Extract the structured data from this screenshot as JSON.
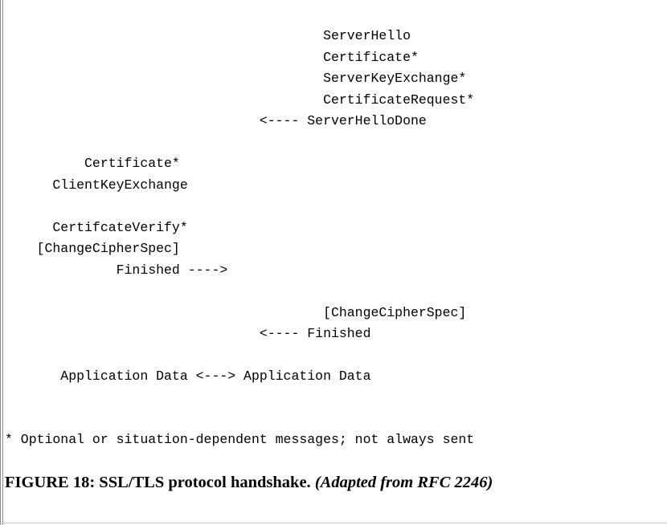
{
  "diagram": {
    "lines": [
      {
        "text": "                                        ServerHello"
      },
      {
        "text": "                                        Certificate*"
      },
      {
        "text": "                                        ServerKeyExchange*"
      },
      {
        "text": "                                        CertificateRequest*"
      },
      {
        "text": "                                <---- ServerHelloDone"
      },
      {
        "text": ""
      },
      {
        "text": "          Certificate*"
      },
      {
        "text": "      ClientKeyExchange"
      },
      {
        "text": ""
      },
      {
        "text": "      CertifcateVerify*"
      },
      {
        "text": "    [ChangeCipherSpec]"
      },
      {
        "text": "              Finished ---->"
      },
      {
        "text": ""
      },
      {
        "text": "                                        [ChangeCipherSpec]"
      },
      {
        "text": "                                <---- Finished"
      },
      {
        "text": ""
      },
      {
        "text": "       Application Data <---> Application Data"
      }
    ],
    "footnote": "* Optional or situation-dependent messages; not always sent",
    "caption_bold": "FIGURE 18: SSL/TLS protocol handshake. ",
    "caption_italic": "(Adapted from RFC 2246)"
  }
}
